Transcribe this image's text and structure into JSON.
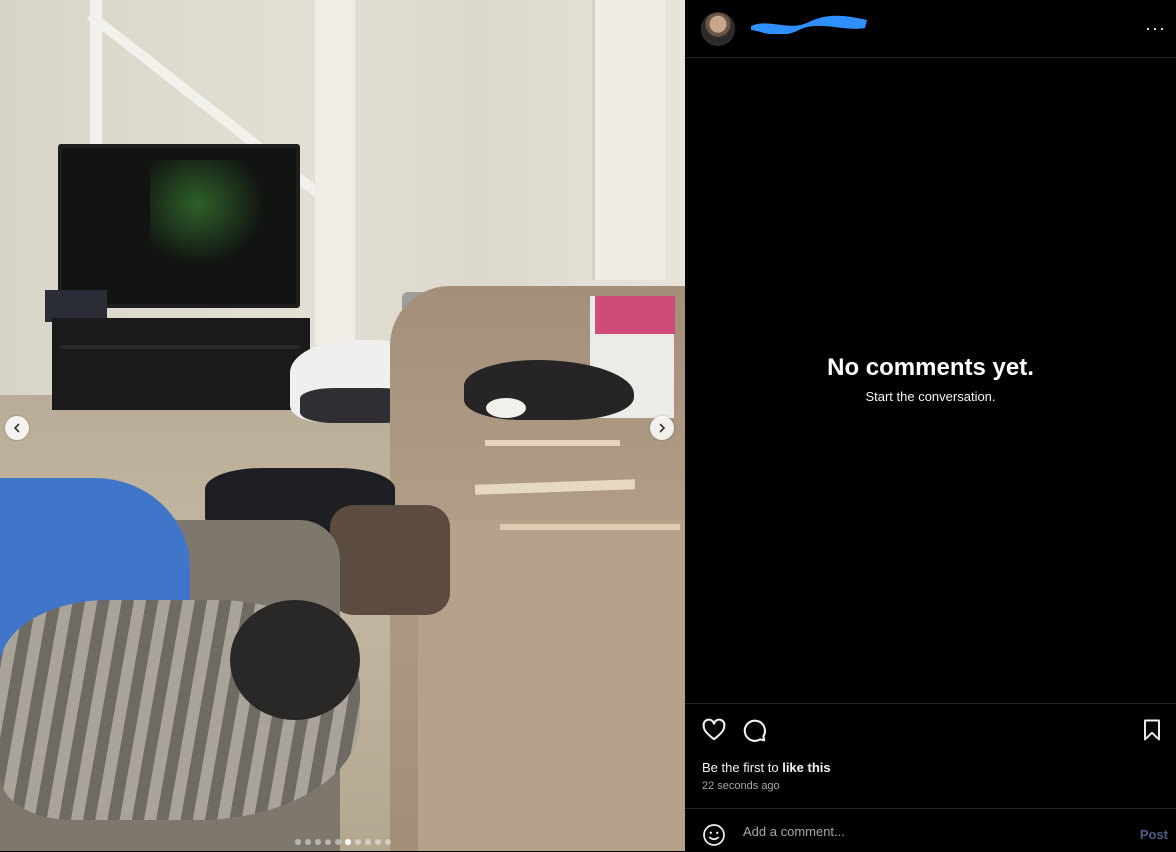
{
  "post": {
    "username": "",
    "more_label": "···",
    "carousel": {
      "slide_count": 10,
      "active_index": 5
    }
  },
  "comments": {
    "empty_title": "No comments yet.",
    "empty_subtitle": "Start the conversation."
  },
  "engagement": {
    "likes_prefix": "Be the first to ",
    "likes_action": "like this",
    "timestamp": "22 seconds ago"
  },
  "composer": {
    "placeholder": "Add a comment...",
    "post_label": "Post"
  },
  "colors": {
    "redaction": "#2f8fff",
    "post_disabled": "#4a5d7e"
  }
}
